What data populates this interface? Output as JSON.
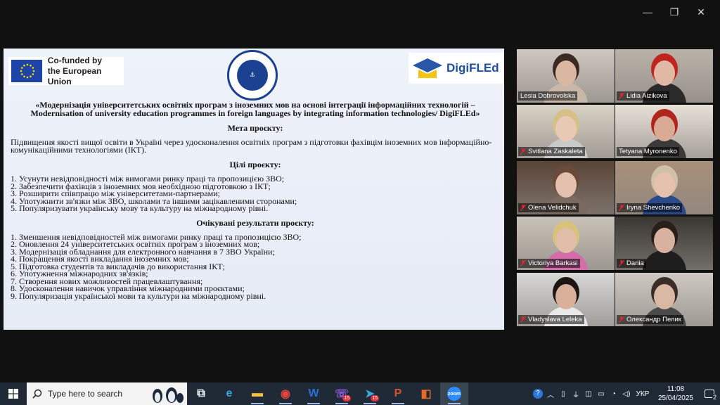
{
  "window": {
    "minimize": "—",
    "maximize": "❐",
    "close": "✕"
  },
  "slide": {
    "eu_logo_text": [
      "Co-funded by",
      "the European Union"
    ],
    "digifled_logo": "DigiFLEd",
    "title": "«Модернізація університетських освітніх програм з іноземних мов на основі інтеграції інформаційних технологій – Modernisation of university education programmes in foreign languages by integrating information technologies/ DigiFLEd»",
    "goal_heading": "Мета проєкту:",
    "goal_text": "Підвищення якості вищої освіти в Україні через удосконалення освітніх програм з підготовки фахівцім іноземних мов інформаційно-комунікаційними технологіями (ІКТ).",
    "objectives_heading": "Цілі проєкту:",
    "objectives": [
      "1. Усунути невідповідності між вимогами ринку праці та пропозицією ЗВО;",
      "2. Забезпечити фахівців з іноземних мов необхідною підготовкою з ІКТ;",
      "3. Розширити співпрацю між університетами-партнерами;",
      "4. Употужнити зв'язки між ЗВО, школами та іншими зацікавленими сторонами;",
      "5. Популяризувати українську мову та культуру на міжнародному рівні."
    ],
    "results_heading": "Очікувані результати проєкту:",
    "results": [
      "1. Зменшення невідповідностей між вимогами ринку праці та пропозицією ЗВО;",
      "2. Оновлення 24 університетських освітніх програм з іноземних мов;",
      "3. Модернізація обладнання для електронного навчання в 7 ЗВО України;",
      "4. Покращення якості викладання іноземних мов;",
      "5. Підготовка студентів та викладачів до використання ІКТ;",
      "6. Употужнення міжнародних зв'язків;",
      "7. Створення нових можливостей працевлаштування;",
      "8. Удосконалення навичок управління міжнародними проєктами;",
      "9. Популяризація української мови та культури на міжнародному рівні."
    ]
  },
  "participants": [
    {
      "name": "Lesia Dobrovolska",
      "muted": false,
      "active": false,
      "bg": "#cfc8c0",
      "skin": "#d9b7a0",
      "hair": "#3b2a22",
      "cloth": "#c9b8a8"
    },
    {
      "name": "Lidia Aizikova",
      "muted": true,
      "active": false,
      "bg": "#b9b2a8",
      "skin": "#e0b8a4",
      "hair": "#c0241e",
      "cloth": "#2a2a2a"
    },
    {
      "name": "Svitlana Zaskaleta",
      "muted": true,
      "active": false,
      "bg": "#d9d2c6",
      "skin": "#e8c9b4",
      "hair": "#d6c08a",
      "cloth": "#c9c9c9"
    },
    {
      "name": "Tetyana Myronenko",
      "muted": false,
      "active": true,
      "bg": "#e8e1d8",
      "skin": "#d9aa96",
      "hair": "#b0261e",
      "cloth": "#3a3a3a"
    },
    {
      "name": "Olena Velidchuk",
      "muted": true,
      "active": false,
      "bg": "#5a4538",
      "skin": "#e4c0ae",
      "hair": "#6b4a3a",
      "cloth": "#7a6a60"
    },
    {
      "name": "Iryna Shevchenko",
      "muted": true,
      "active": false,
      "bg": "#a8907a",
      "skin": "#e6c2ae",
      "hair": "#cfc1a8",
      "cloth": "#2a4a8a"
    },
    {
      "name": "Victoriya Barkasi",
      "muted": true,
      "active": false,
      "bg": "#c9c2b8",
      "skin": "#e0bea8",
      "hair": "#d8c27a",
      "cloth": "#d46ea8"
    },
    {
      "name": "Dariia",
      "muted": true,
      "active": false,
      "bg": "#3a3632",
      "skin": "#d8b29e",
      "hair": "#2a1e18",
      "cloth": "#1e1e1e"
    },
    {
      "name": "Vladyslava Leleka",
      "muted": true,
      "active": false,
      "bg": "#d8d8d8",
      "skin": "#d9b09a",
      "hair": "#1e1612",
      "cloth": "#e8e8e8"
    },
    {
      "name": "Олександр Пелик",
      "muted": true,
      "active": false,
      "bg": "#cfc9c2",
      "skin": "#d9b8a4",
      "hair": "#3a2e26",
      "cloth": "#4a4a4a"
    }
  ],
  "taskbar": {
    "search_placeholder": "Type here to search",
    "apps": [
      {
        "name": "task-view",
        "glyph": "⧉",
        "color": "#ffffff",
        "open": false,
        "badge": ""
      },
      {
        "name": "edge",
        "glyph": "e",
        "color": "#3aa6e8",
        "open": false,
        "badge": ""
      },
      {
        "name": "file-explorer",
        "glyph": "▬",
        "color": "#f0c240",
        "open": true,
        "badge": ""
      },
      {
        "name": "chrome",
        "glyph": "◉",
        "color": "#e8463a",
        "open": true,
        "badge": ""
      },
      {
        "name": "word",
        "glyph": "W",
        "color": "#2b6ed6",
        "open": true,
        "badge": ""
      },
      {
        "name": "viber",
        "glyph": "☏",
        "color": "#8a5ad6",
        "open": true,
        "badge": "15"
      },
      {
        "name": "telegram",
        "glyph": "➤",
        "color": "#38a8e0",
        "open": true,
        "badge": "15"
      },
      {
        "name": "powerpoint",
        "glyph": "P",
        "color": "#d6502e",
        "open": true,
        "badge": ""
      },
      {
        "name": "office",
        "glyph": "◧",
        "color": "#e86a24",
        "open": false,
        "badge": ""
      },
      {
        "name": "zoom",
        "glyph": "zoom",
        "color": "#2d8cff",
        "open": true,
        "badge": ""
      }
    ],
    "language": "УКР",
    "time": "11:08",
    "date": "25/04/2025",
    "notifications": "2"
  }
}
